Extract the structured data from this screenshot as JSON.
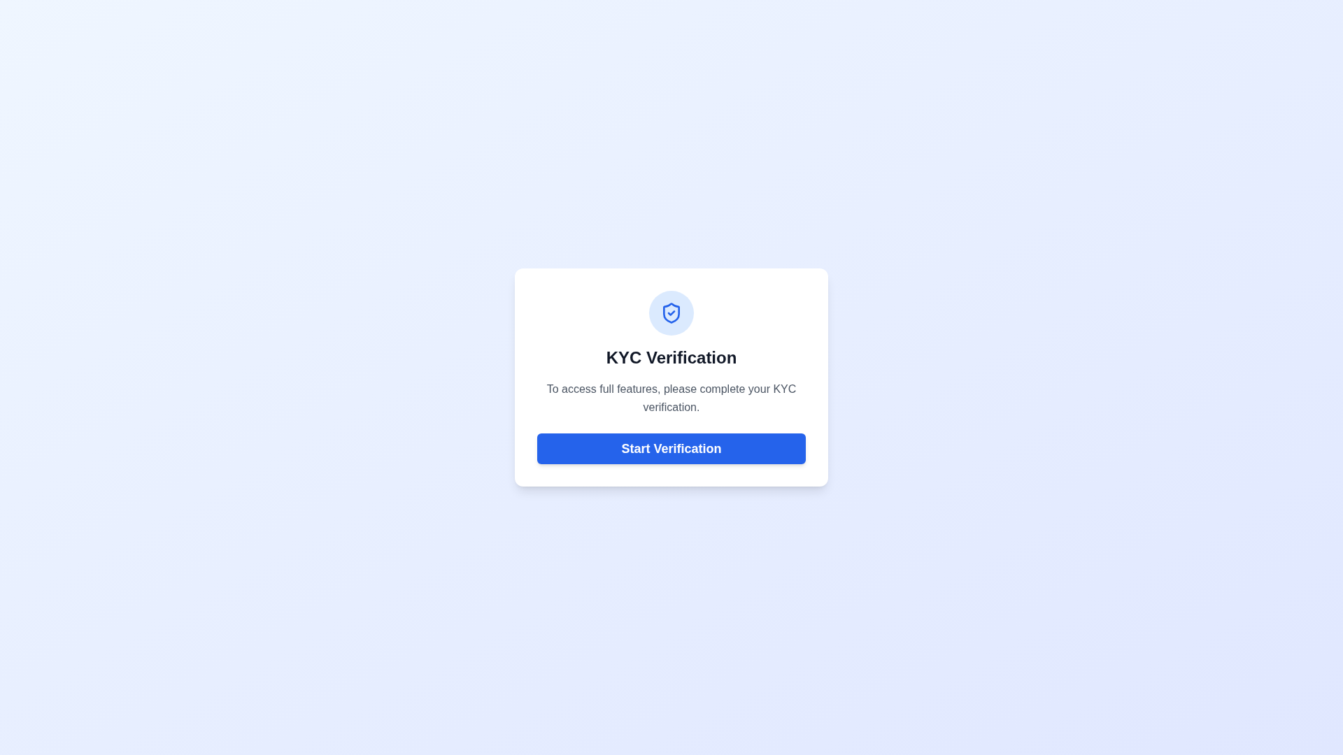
{
  "card": {
    "title": "KYC Verification",
    "description": "To access full features, please complete your KYC verification.",
    "button": "Start Verification"
  }
}
